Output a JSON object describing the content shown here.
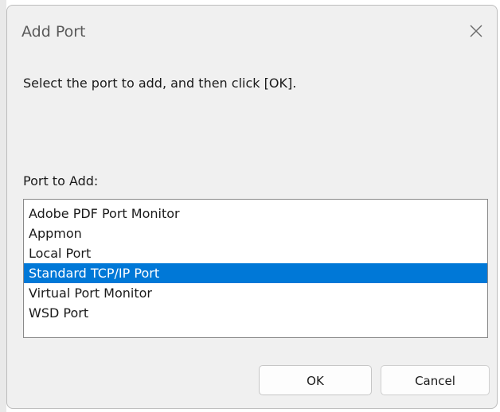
{
  "dialog": {
    "title": "Add Port",
    "close_icon": "close-icon",
    "instruction": "Select the port to add, and then click [OK].",
    "list_label": "Port to Add:",
    "items": [
      {
        "label": "Adobe PDF Port Monitor",
        "selected": false
      },
      {
        "label": "Appmon",
        "selected": false
      },
      {
        "label": "Local Port",
        "selected": false
      },
      {
        "label": "Standard TCP/IP Port",
        "selected": true
      },
      {
        "label": "Virtual Port Monitor",
        "selected": false
      },
      {
        "label": "WSD Port",
        "selected": false
      }
    ],
    "ok_label": "OK",
    "cancel_label": "Cancel"
  },
  "colors": {
    "selection": "#0078d7",
    "dialog_bg": "#f0f0f0"
  }
}
